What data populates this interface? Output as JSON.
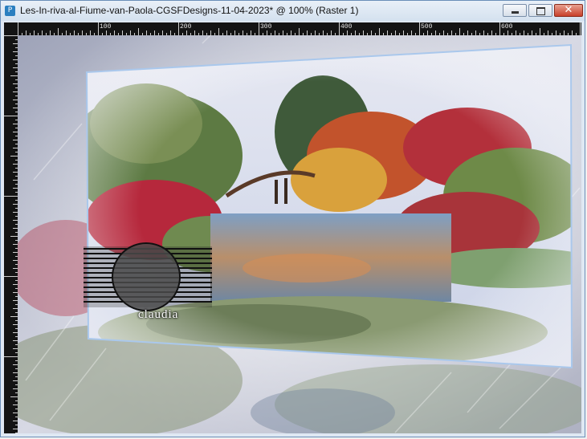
{
  "window": {
    "title": "Les-In-riva-al-Fiume-van-Paola-CGSFDesigns-11-04-2023* @ 100% (Raster 1)",
    "app_icon_glyph": "P",
    "close_glyph": "✕"
  },
  "ruler": {
    "labels": [
      "100",
      "200",
      "300",
      "400",
      "500",
      "600"
    ]
  },
  "artwork": {
    "watermark_text": "claudia"
  },
  "colors": {
    "ruler_bg": "#141414",
    "title_bar": "#dbe6f2",
    "close_button": "#c8402a"
  }
}
